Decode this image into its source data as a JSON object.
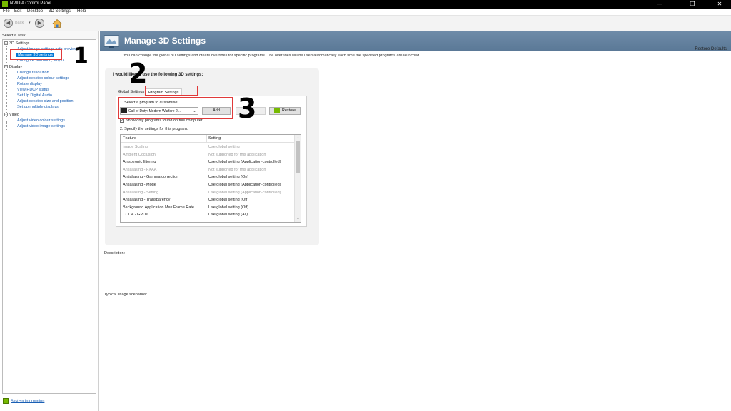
{
  "window": {
    "title": "NVIDIA Control Panel",
    "controls": {
      "minimize": "—",
      "maximize": "❐",
      "close": "✕"
    }
  },
  "menu": [
    "File",
    "Edit",
    "Desktop",
    "3D Settings",
    "Help"
  ],
  "toolbar": {
    "back_label": "Back",
    "back_icon": "left-arrow-icon",
    "forward_icon": "right-arrow-icon",
    "home_icon": "home-icon"
  },
  "sidebar": {
    "header": "Select a Task...",
    "tree": [
      {
        "label": "3D Settings",
        "type": "node",
        "children": [
          {
            "label": "Adjust image settings with preview"
          },
          {
            "label": "Manage 3D settings",
            "selected": true
          },
          {
            "label": "Configure Surround, PhysX"
          }
        ]
      },
      {
        "label": "Display",
        "type": "node",
        "children": [
          {
            "label": "Change resolution"
          },
          {
            "label": "Adjust desktop colour settings"
          },
          {
            "label": "Rotate display"
          },
          {
            "label": "View HDCP status"
          },
          {
            "label": "Set Up Digital Audio"
          },
          {
            "label": "Adjust desktop size and position"
          },
          {
            "label": "Set up multiple displays"
          }
        ]
      },
      {
        "label": "Video",
        "type": "node",
        "children": [
          {
            "label": "Adjust video colour settings"
          },
          {
            "label": "Adjust video image settings"
          }
        ]
      }
    ],
    "footer_link": "System Information"
  },
  "page": {
    "title": "Manage 3D Settings",
    "description": "You can change the global 3D settings and create overrides for specific programs. The overrides will be used automatically each time the specified programs are launched.",
    "restore_defaults": "Restore Defaults",
    "heading": "I would like to use the following 3D settings:",
    "tabs": [
      {
        "label": "Global Settings",
        "active": false
      },
      {
        "label": "Program Settings",
        "active": true
      }
    ],
    "step1_label": "1. Select a program to customise:",
    "selected_program": "Call of Duty: Modern Warfare 2...",
    "add_button": "Add",
    "remove_button": "",
    "restore_button": "Restore",
    "show_only_label": "Show only programs found on this computer",
    "show_only_checked": true,
    "step2_label": "2. Specify the settings for this program:",
    "table_headers": {
      "feature": "Feature",
      "setting": "Setting"
    },
    "features": [
      {
        "feature": "Image Scaling",
        "setting": "Use global setting",
        "dim": true
      },
      {
        "feature": "Ambient Occlusion",
        "setting": "Not supported for this application",
        "dim": true
      },
      {
        "feature": "Anisotropic filtering",
        "setting": "Use global setting (Application-controlled)",
        "dim": false
      },
      {
        "feature": "Antialiasing - FXAA",
        "setting": "Not supported for this application",
        "dim": true
      },
      {
        "feature": "Antialiasing - Gamma correction",
        "setting": "Use global setting (On)",
        "dim": false
      },
      {
        "feature": "Antialiasing - Mode",
        "setting": "Use global setting (Application-controlled)",
        "dim": false
      },
      {
        "feature": "Antialiasing - Setting",
        "setting": "Use global setting (Application-controlled)",
        "dim": true
      },
      {
        "feature": "Antialiasing - Transparency",
        "setting": "Use global setting (Off)",
        "dim": false
      },
      {
        "feature": "Background Application Max Frame Rate",
        "setting": "Use global setting (Off)",
        "dim": false
      },
      {
        "feature": "CUDA - GPUs",
        "setting": "Use global setting (All)",
        "dim": false
      }
    ],
    "description_label": "Description:",
    "usage_label": "Typical usage scenarios:"
  },
  "annotations": [
    "1",
    "2",
    "3"
  ],
  "colors": {
    "nvidia_green": "#76b900",
    "highlight_red": "#e03a3a",
    "banner": "#6e8ba8",
    "selection": "#0078d7"
  }
}
